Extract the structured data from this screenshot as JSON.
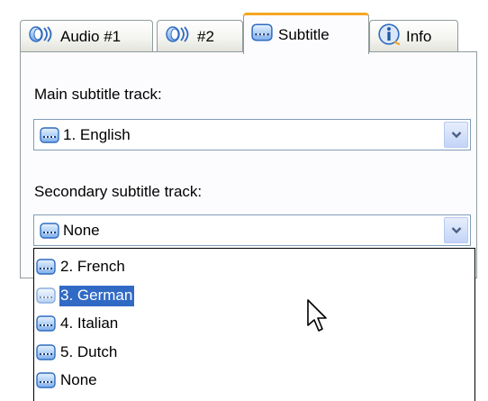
{
  "tabs": [
    {
      "label": "Audio #1",
      "icon": "speaker-icon",
      "selected": false
    },
    {
      "label": "#2",
      "icon": "speaker-icon",
      "selected": false
    },
    {
      "label": "Subtitle",
      "icon": "subtitle-icon",
      "selected": true
    },
    {
      "label": "Info",
      "icon": "info-icon",
      "selected": false
    }
  ],
  "main_track": {
    "label": "Main subtitle track:",
    "value": "1. English"
  },
  "secondary_track": {
    "label": "Secondary subtitle track:",
    "value": "None"
  },
  "dropdown": {
    "items": [
      {
        "label": "2. French",
        "highlighted": false
      },
      {
        "label": "3. German",
        "highlighted": true
      },
      {
        "label": "4. Italian",
        "highlighted": false
      },
      {
        "label": "5. Dutch",
        "highlighted": false
      },
      {
        "label": "None",
        "highlighted": false
      }
    ]
  },
  "colors": {
    "selected_tab_accent": "#f5a623",
    "highlight": "#316ac5",
    "border": "#919b9c"
  }
}
